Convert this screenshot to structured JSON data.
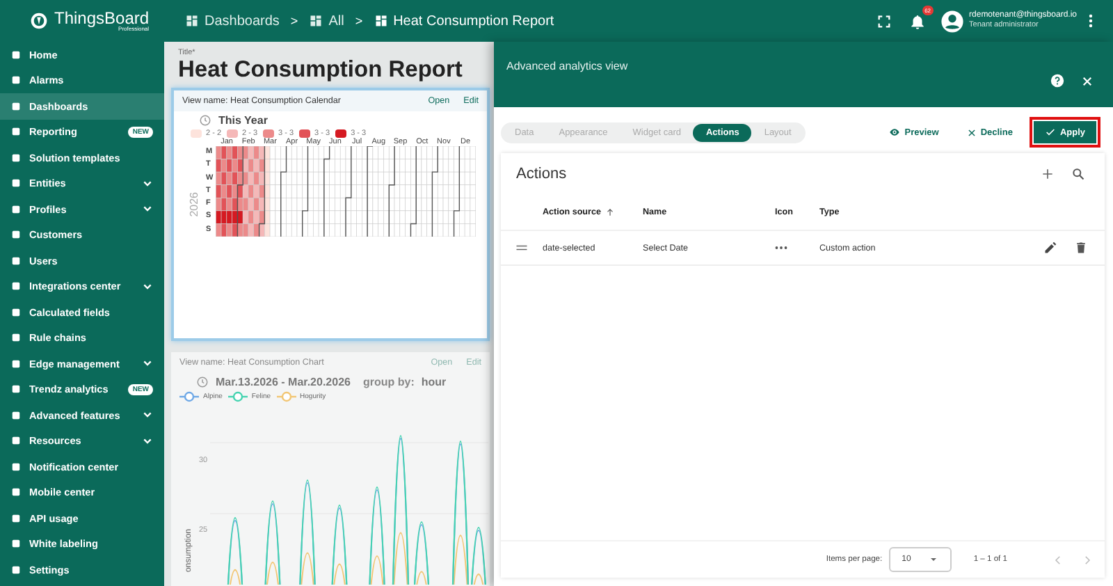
{
  "header": {
    "logo": {
      "name": "ThingsBoard",
      "edition": "Professional"
    },
    "breadcrumbs": [
      {
        "label": "Dashboards",
        "separator": ">"
      },
      {
        "label": "All",
        "separator": ">"
      },
      {
        "label": "Heat Consumption Report"
      }
    ],
    "notifications": {
      "count": "62"
    },
    "user": {
      "email": "rdemotenant@thingsboard.io",
      "role": "Tenant administrator"
    }
  },
  "sidebar": {
    "items": [
      {
        "label": "Home",
        "selected": false,
        "expandable": false
      },
      {
        "label": "Alarms",
        "selected": false,
        "expandable": false
      },
      {
        "label": "Dashboards",
        "selected": true,
        "expandable": false
      },
      {
        "label": "Reporting",
        "selected": false,
        "expandable": false,
        "badge": "NEW"
      },
      {
        "label": "Solution templates",
        "selected": false,
        "expandable": false
      },
      {
        "label": "Entities",
        "selected": false,
        "expandable": true
      },
      {
        "label": "Profiles",
        "selected": false,
        "expandable": true
      },
      {
        "label": "Customers",
        "selected": false,
        "expandable": false
      },
      {
        "label": "Users",
        "selected": false,
        "expandable": false
      },
      {
        "label": "Integrations center",
        "selected": false,
        "expandable": true
      },
      {
        "label": "Calculated fields",
        "selected": false,
        "expandable": false
      },
      {
        "label": "Rule chains",
        "selected": false,
        "expandable": false
      },
      {
        "label": "Edge management",
        "selected": false,
        "expandable": true
      },
      {
        "label": "Trendz analytics",
        "selected": false,
        "expandable": false,
        "badge": "NEW"
      },
      {
        "label": "Advanced features",
        "selected": false,
        "expandable": true
      },
      {
        "label": "Resources",
        "selected": false,
        "expandable": true
      },
      {
        "label": "Notification center",
        "selected": false,
        "expandable": false
      },
      {
        "label": "Mobile center",
        "selected": false,
        "expandable": false
      },
      {
        "label": "API usage",
        "selected": false,
        "expandable": false
      },
      {
        "label": "White labeling",
        "selected": false,
        "expandable": false
      },
      {
        "label": "Settings",
        "selected": false,
        "expandable": false
      }
    ]
  },
  "dashboard": {
    "title_label": "Title*",
    "title": "Heat Consumption Report",
    "widgets": [
      {
        "kind": "calendar",
        "editing": true,
        "view_name": "View name: Heat Consumption Calendar",
        "open": "Open",
        "edit": "Edit",
        "range": "This Year",
        "legend": [
          {
            "label": "2 - 2",
            "color": "#fde3dc"
          },
          {
            "label": "2 - 3",
            "color": "#f5b8b8"
          },
          {
            "label": "3 - 3",
            "color": "#ec8a8a"
          },
          {
            "label": "3 - 3",
            "color": "#e25358"
          },
          {
            "label": "3 - 3",
            "color": "#d51a22"
          }
        ],
        "months": [
          "Jan",
          "Feb",
          "Mar",
          "Apr",
          "May",
          "Jun",
          "Jul",
          "Aug",
          "Sep",
          "Oct",
          "Nov",
          "De"
        ],
        "days": [
          "M",
          "T",
          "W",
          "T",
          "F",
          "S",
          "S"
        ],
        "year": "2026"
      },
      {
        "kind": "chart",
        "editing": false,
        "view_name": "View name: Heat Consumption Chart",
        "open": "Open",
        "edit": "Edit",
        "range": "Mar.13.2026 - Mar.20.2026",
        "group_by_label": "group by:",
        "group_by": "hour",
        "legend": [
          {
            "label": "Alpine",
            "color": "#6ea8e6"
          },
          {
            "label": "Feline",
            "color": "#45d3b0"
          },
          {
            "label": "Hogurity",
            "color": "#f2c673"
          }
        ],
        "yticks": [
          "30",
          "25"
        ],
        "ylabel": "onsumption"
      }
    ]
  },
  "panel": {
    "title": "Advanced analytics view",
    "tabs": [
      {
        "label": "Data",
        "selected": false
      },
      {
        "label": "Appearance",
        "selected": false
      },
      {
        "label": "Widget card",
        "selected": false
      },
      {
        "label": "Actions",
        "selected": true
      },
      {
        "label": "Layout",
        "selected": false
      }
    ],
    "preview": "Preview",
    "decline": "Decline",
    "apply": {
      "label": "Apply",
      "highlighted": true
    },
    "actions": {
      "title": "Actions",
      "columns": [
        {
          "label": "Action source",
          "sorted": true
        },
        {
          "label": "Name",
          "sorted": false
        },
        {
          "label": "Icon",
          "sorted": false
        },
        {
          "label": "Type",
          "sorted": false
        }
      ],
      "rows": [
        {
          "source": "date-selected",
          "name": "Select Date",
          "type": "Custom action"
        }
      ],
      "paginator": {
        "label": "Items per page:",
        "page_size": "10",
        "range": "1 – 1 of 1"
      }
    }
  }
}
